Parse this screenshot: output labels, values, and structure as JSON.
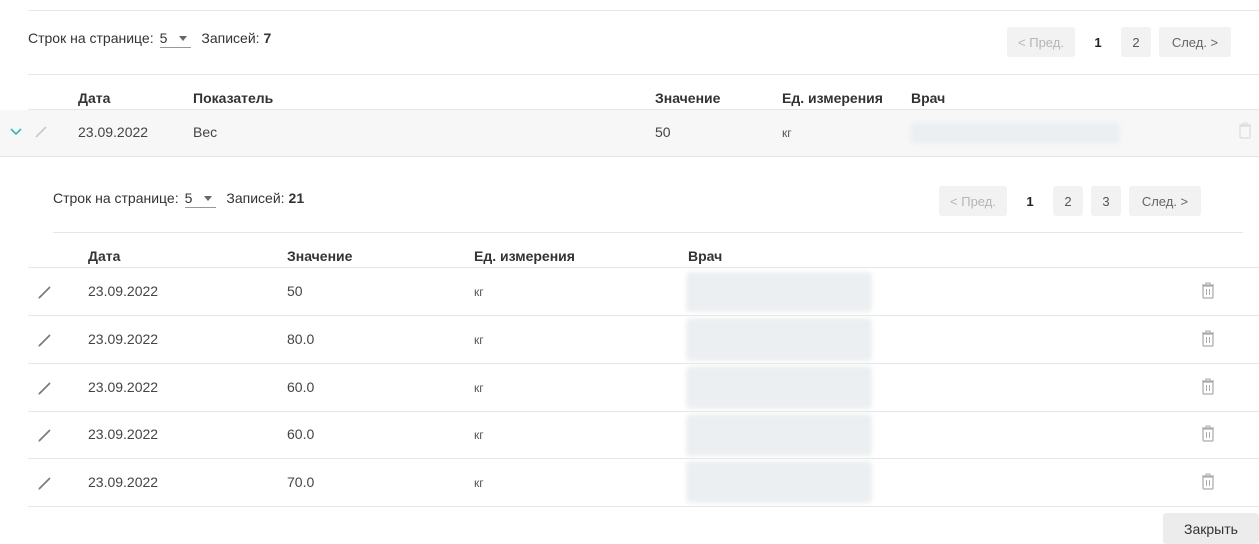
{
  "outer": {
    "rows_per_page_label": "Строк на странице:",
    "rows_per_page_value": "5",
    "records_label": "Записей:",
    "records_count": "7",
    "pagination": {
      "prev": "< Пред.",
      "pages": [
        "1",
        "2"
      ],
      "next": "След. >"
    },
    "columns": {
      "date": "Дата",
      "indicator": "Показатель",
      "value": "Значение",
      "unit": "Ед. измерения",
      "doctor": "Врач"
    },
    "row": {
      "date": "23.09.2022",
      "indicator": "Вес",
      "value": "50",
      "unit": "кг"
    }
  },
  "inner": {
    "rows_per_page_label": "Строк на странице:",
    "rows_per_page_value": "5",
    "records_label": "Записей:",
    "records_count": "21",
    "pagination": {
      "prev": "< Пред.",
      "pages": [
        "1",
        "2",
        "3"
      ],
      "next": "След. >"
    },
    "columns": {
      "date": "Дата",
      "value": "Значение",
      "unit": "Ед. измерения",
      "doctor": "Врач"
    },
    "rows": [
      {
        "date": "23.09.2022",
        "value": "50",
        "unit": "кг"
      },
      {
        "date": "23.09.2022",
        "value": "80.0",
        "unit": "кг"
      },
      {
        "date": "23.09.2022",
        "value": "60.0",
        "unit": "кг"
      },
      {
        "date": "23.09.2022",
        "value": "60.0",
        "unit": "кг"
      },
      {
        "date": "23.09.2022",
        "value": "70.0",
        "unit": "кг"
      }
    ]
  },
  "close_label": "Закрыть",
  "colors": {
    "accent": "#39b5b5",
    "icon": "#777777",
    "border": "#e6e6e6"
  }
}
